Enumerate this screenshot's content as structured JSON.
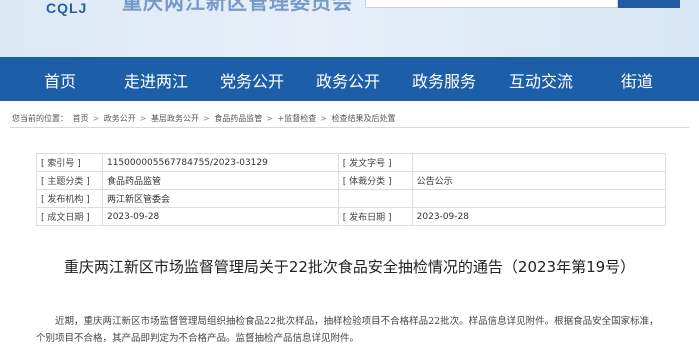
{
  "header": {
    "logo_text": "CQLJ",
    "site_title": "重庆两江新区管理委员会"
  },
  "nav": {
    "items": [
      "首页",
      "走进两江",
      "党务公开",
      "政务公开",
      "政务服务",
      "互动交流",
      "街道"
    ]
  },
  "breadcrumb": {
    "prefix": "您当前的位置：",
    "items": [
      "首页",
      "政务公开",
      "基层政务公开",
      "食品药品监管",
      "+监督检查",
      "检查结果及后处置"
    ]
  },
  "info": {
    "index_label": "[ 索引号 ]",
    "index_value": "115000005567784755/2023-03129",
    "doc_no_label": "[ 发文字号 ]",
    "doc_no_value": "",
    "topic_label": "[ 主题分类 ]",
    "topic_value": "食品药品监管",
    "genre_label": "[ 体裁分类 ]",
    "genre_value": "公告公示",
    "issuer_label": "[ 发布机构 ]",
    "issuer_value": "两江新区管委会",
    "created_label": "[ 成文日期 ]",
    "created_value": "2023-09-28",
    "published_label": "[ 发布日期 ]",
    "published_value": "2023-09-28"
  },
  "article": {
    "title": "重庆两江新区市场监督管理局关于22批次食品安全抽检情况的通告（2023年第19号）",
    "body": "近期，重庆两江新区市场监督管理局组织抽检食品22批次样品，抽样检验项目不合格样品22批次。样品信息详见附件。根据食品安全国家标准，个别项目不合格，其产品即判定为不合格产品。监督抽检产品信息详见附件。"
  }
}
